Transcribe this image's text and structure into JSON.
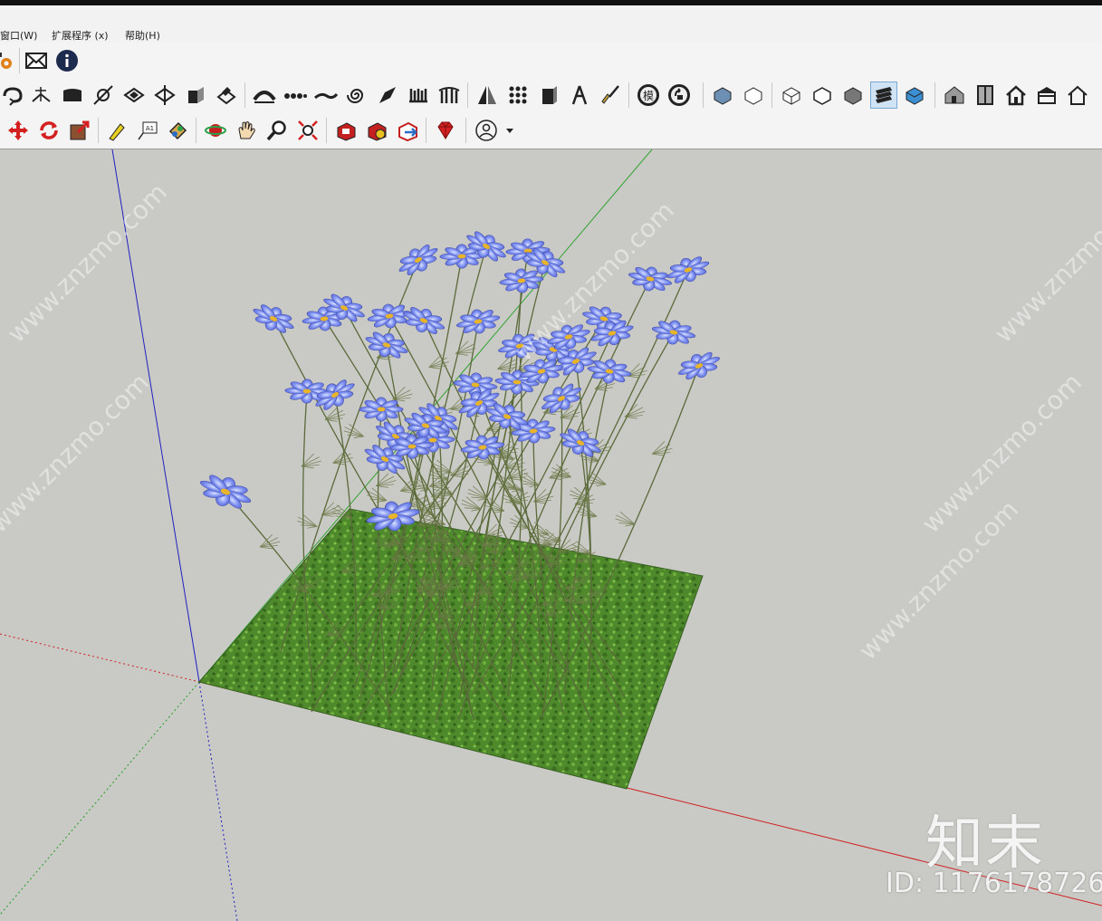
{
  "menu": {
    "items": [
      "窗口(W)",
      "扩展程序 (x)",
      "帮助(H)"
    ]
  },
  "toolbar_row1": {
    "icons": [
      "settings-icon",
      "email-icon",
      "info-icon"
    ]
  },
  "toolbar_row2": {
    "icons": [
      "follow-me-icon",
      "intersect-icon",
      "face-icon",
      "line-tool-icon",
      "flip-icon",
      "split-icon",
      "box-icon",
      "eraser-icon",
      "arc-icon",
      "chain-icon",
      "curve-icon",
      "spiral-icon",
      "shovel-icon",
      "comb-icon",
      "columns-icon",
      "mirror-icon",
      "grid-icon",
      "block-icon",
      "compass-icon",
      "brush-icon",
      "model-icon",
      "refresh-icon",
      "iso-view-icon",
      "top-view-icon",
      "front-view-icon",
      "right-view-icon",
      "back-view-icon",
      "layers-icon",
      "shaded-icon",
      "house-icon",
      "door-icon",
      "home-icon",
      "roof-icon",
      "outline-house-icon"
    ],
    "model_label": "模"
  },
  "toolbar_row3": {
    "icons": [
      "move-icon",
      "rotate-icon",
      "scale-icon",
      "tape-measure-icon",
      "text-icon",
      "paint-bucket-icon",
      "orbit-icon",
      "pan-icon",
      "zoom-icon",
      "zoom-extents-icon",
      "warehouse-icon",
      "extension-icon",
      "share-icon",
      "ruby-icon",
      "user-icon"
    ],
    "text_label": "A1"
  },
  "watermark": {
    "site": "www.znzmo.com",
    "logo": "知末",
    "id": "ID: 1176178726"
  },
  "colors": {
    "axis_red": "#d02020",
    "axis_green": "#20a020",
    "axis_blue": "#2020c0",
    "grass": "#4e8a2c",
    "flower": "#6f7fe6",
    "background": "#c9c9c5"
  }
}
